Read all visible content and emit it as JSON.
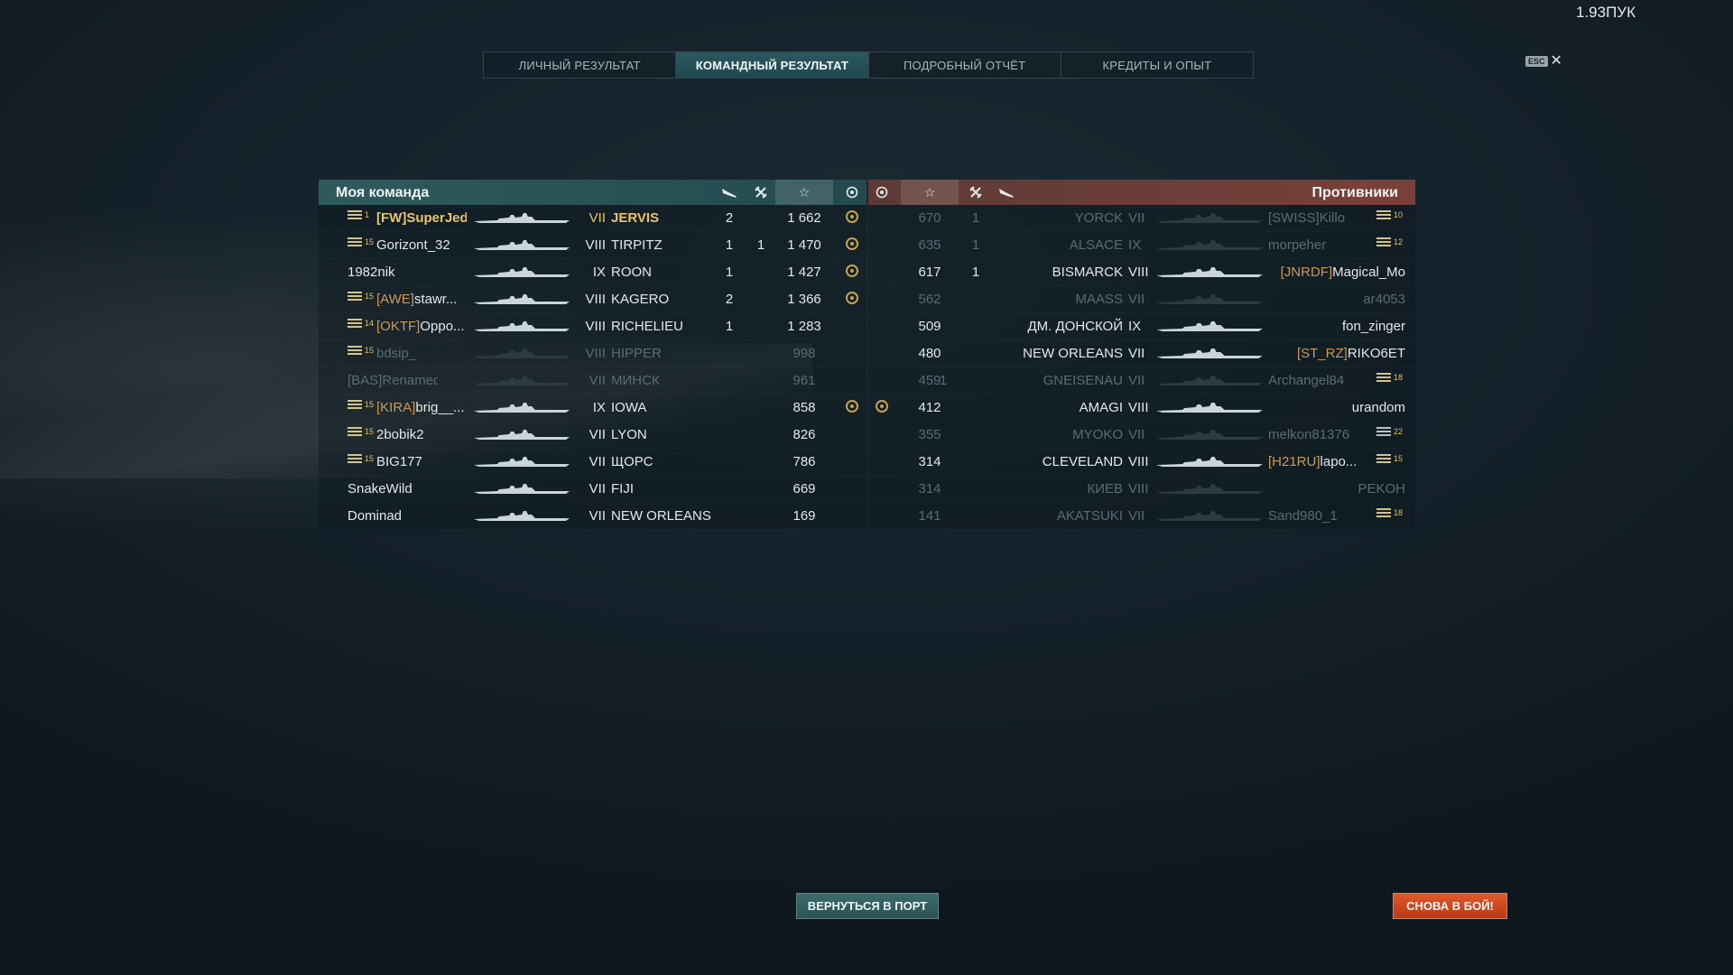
{
  "version": "1.93ПУК",
  "tabs": [
    "ЛИЧНЫЙ РЕЗУЛЬТАТ",
    "КОМАНДНЫЙ РЕЗУЛЬТАТ",
    "ПОДРОБНЫЙ ОТЧЁТ",
    "КРЕДИТЫ И ОПЫТ"
  ],
  "active_tab": "КОМАНДНЫЙ РЕЗУЛЬТАТ",
  "esc_label": "ESC",
  "my_team": {
    "title": "Моя команда",
    "rows": [
      {
        "rank": "1",
        "clan": "[FW]",
        "name": "SuperJed...",
        "tier": "VII",
        "ship": "JERVIS",
        "col_a": "2",
        "col_b": "",
        "xp": "1 662",
        "medal": true,
        "alive": true,
        "self": true
      },
      {
        "rank": "15",
        "clan": "",
        "name": "Gorizont_32",
        "tier": "VIII",
        "ship": "TIRPITZ",
        "col_a": "1",
        "col_b": "1",
        "xp": "1 470",
        "medal": true,
        "alive": true
      },
      {
        "rank": "",
        "clan": "",
        "name": "1982nik",
        "tier": "IX",
        "ship": "ROON",
        "col_a": "1",
        "col_b": "",
        "xp": "1 427",
        "medal": true,
        "alive": true
      },
      {
        "rank": "15",
        "clan": "[AWE]",
        "name": "stawr...",
        "tier": "VIII",
        "ship": "KAGERO",
        "col_a": "2",
        "col_b": "",
        "xp": "1 366",
        "medal": true,
        "alive": true
      },
      {
        "rank": "14",
        "clan": "[OKTF]",
        "name": "Oppo...",
        "tier": "VIII",
        "ship": "RICHELIEU",
        "col_a": "1",
        "col_b": "",
        "xp": "1 283",
        "medal": false,
        "alive": true
      },
      {
        "rank": "15",
        "clan": "",
        "name": "bdsip_",
        "tier": "VIII",
        "ship": "HIPPER",
        "col_a": "",
        "col_b": "",
        "xp": "998",
        "medal": false,
        "alive": false
      },
      {
        "rank": "",
        "clan": "[BAS]",
        "name": "RenamedUse",
        "tier": "VII",
        "ship": "МИНСК",
        "col_a": "",
        "col_b": "",
        "xp": "961",
        "medal": false,
        "alive": false
      },
      {
        "rank": "15",
        "clan": "[KIRA]",
        "name": "brig__...",
        "tier": "IX",
        "ship": "IOWA",
        "col_a": "",
        "col_b": "",
        "xp": "858",
        "medal": true,
        "alive": true
      },
      {
        "rank": "15",
        "clan": "",
        "name": "2bobik2",
        "tier": "VII",
        "ship": "LYON",
        "col_a": "",
        "col_b": "",
        "xp": "826",
        "medal": false,
        "alive": true
      },
      {
        "rank": "15",
        "clan": "",
        "name": "BIG177",
        "tier": "VII",
        "ship": "ЩОРС",
        "col_a": "",
        "col_b": "",
        "xp": "786",
        "medal": false,
        "alive": true
      },
      {
        "rank": "",
        "clan": "",
        "name": "SnakeWild",
        "tier": "VII",
        "ship": "FIJI",
        "col_a": "",
        "col_b": "",
        "xp": "669",
        "medal": false,
        "alive": true
      },
      {
        "rank": "",
        "clan": "",
        "name": "Dominad",
        "tier": "VII",
        "ship": "NEW ORLEANS",
        "col_a": "",
        "col_b": "",
        "xp": "169",
        "medal": false,
        "alive": true
      }
    ]
  },
  "enemy_team": {
    "title": "Противники",
    "rows": [
      {
        "xp": "670",
        "col_b": "",
        "col_a": "1",
        "ship": "YORCK",
        "tier": "VII",
        "clan": "[SWISS]",
        "name": "Killo",
        "rank": "10",
        "medal": false,
        "alive": false
      },
      {
        "xp": "635",
        "col_b": "",
        "col_a": "1",
        "ship": "ALSACE",
        "tier": "IX",
        "clan": "",
        "name": "morpeher",
        "rank": "12",
        "medal": false,
        "alive": false
      },
      {
        "xp": "617",
        "col_b": "",
        "col_a": "1",
        "ship": "BISMARCK",
        "tier": "VIII",
        "clan": "[JNRDF]",
        "name": "Magical_Mo",
        "rank": "",
        "medal": false,
        "alive": true
      },
      {
        "xp": "562",
        "col_b": "",
        "col_a": "",
        "ship": "MAASS",
        "tier": "VII",
        "clan": "",
        "name": "ar4053",
        "rank": "",
        "medal": false,
        "alive": false
      },
      {
        "xp": "509",
        "col_b": "",
        "col_a": "",
        "ship": "ДМ. ДОНСКОЙ",
        "tier": "IX",
        "clan": "",
        "name": "fon_zinger",
        "rank": "",
        "medal": false,
        "alive": true
      },
      {
        "xp": "480",
        "col_b": "",
        "col_a": "",
        "ship": "NEW ORLEANS",
        "tier": "VII",
        "clan": "[ST_RZ]",
        "name": "RIKO6ET",
        "rank": "",
        "medal": false,
        "alive": true
      },
      {
        "xp": "459",
        "col_b": "1",
        "col_a": "",
        "ship": "GNEISENAU",
        "tier": "VII",
        "clan": "",
        "name": "Archangel84",
        "rank": "18",
        "medal": false,
        "alive": false
      },
      {
        "xp": "412",
        "col_b": "",
        "col_a": "",
        "ship": "AMAGI",
        "tier": "VIII",
        "clan": "",
        "name": "urandom",
        "rank": "",
        "medal": true,
        "alive": true
      },
      {
        "xp": "355",
        "col_b": "",
        "col_a": "",
        "ship": "MYOKO",
        "tier": "VII",
        "clan": "",
        "name": "melkon81376",
        "rank": "22",
        "medal": false,
        "alive": false,
        "flat": true
      },
      {
        "xp": "314",
        "col_b": "",
        "col_a": "",
        "ship": "CLEVELAND",
        "tier": "VIII",
        "clan": "[H21RU]",
        "name": "lapo...",
        "rank": "15",
        "medal": false,
        "alive": true
      },
      {
        "xp": "314",
        "col_b": "",
        "col_a": "",
        "ship": "КИЕВ",
        "tier": "VIII",
        "clan": "",
        "name": "PEKOH",
        "rank": "",
        "medal": false,
        "alive": false
      },
      {
        "xp": "141",
        "col_b": "",
        "col_a": "",
        "ship": "AKATSUKI",
        "tier": "VII",
        "clan": "",
        "name": "Sand980_1",
        "rank": "18",
        "medal": false,
        "alive": false
      }
    ]
  },
  "buttons": {
    "port": "ВЕРНУТЬСЯ В ПОРТ",
    "again": "СНОВА В БОЙ!"
  },
  "colors": {
    "my_team": "#2e5a5d",
    "enemy": "#7a4038",
    "clan": "#c89a5c",
    "self": "#e8c46c",
    "again_button": "#e05a2a"
  },
  "icons": {
    "col_a": "plane-icon",
    "col_b": "crossed-swords-icon",
    "xp": "star-icon",
    "medal": "medal-icon"
  }
}
